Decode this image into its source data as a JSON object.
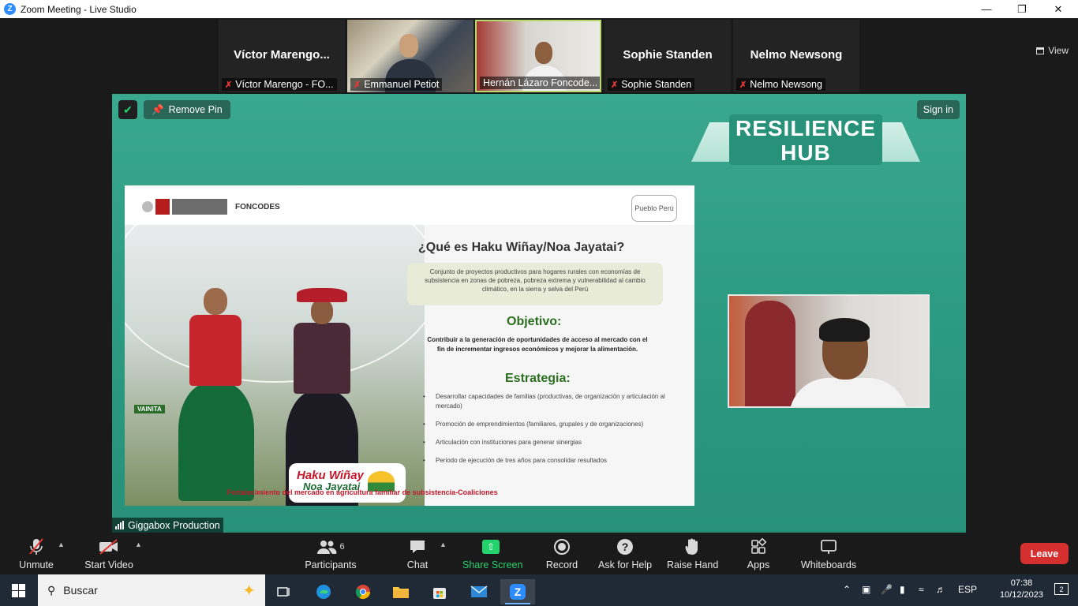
{
  "window": {
    "title": "Zoom Meeting - Live Studio",
    "app_icon": "zoom-icon",
    "controls": [
      "minimize-icon",
      "restore-icon",
      "close-icon"
    ]
  },
  "thumbnails": [
    {
      "big_name": "Víctor  Marengo...",
      "label": "Víctor Marengo - FO...",
      "muted": true,
      "video": false
    },
    {
      "big_name": "",
      "label": "Emmanuel Petiot",
      "muted": true,
      "video": true
    },
    {
      "big_name": "",
      "label": "Hernán Lázaro Foncode...",
      "muted": false,
      "video": true,
      "active": true
    },
    {
      "big_name": "Sophie Standen",
      "label": "Sophie Standen",
      "muted": true,
      "video": false
    },
    {
      "big_name": "Nelmo Newsong",
      "label": "Nelmo Newsong",
      "muted": true,
      "video": false
    }
  ],
  "view_button": {
    "label": "View",
    "icon": "grid-view-icon"
  },
  "share": {
    "remove_pin": "Remove Pin",
    "sign_in": "Sign in",
    "brand": {
      "line1": "RESILIENCE",
      "line2": "HUB"
    },
    "slide": {
      "header_logo_text": "FONCODES",
      "partner_logo_text": "Pueblo Perú",
      "title": "¿Qué es Haku Wiñay/Noa Jayatai?",
      "definition": "Conjunto de proyectos productivos para hogares rurales con economías de subsistencia en zonas de pobreza, pobreza extrema y vulnerabilidad al cambio climático, en la sierra y selva del Perú",
      "objective_heading": "Objetivo:",
      "objective_text": "Contribuir a la generación de oportunidades de acceso al mercado con el fin de incrementar ingresos económicos y mejorar la alimentación.",
      "strategy_heading": "Estrategia:",
      "strategy_items": [
        "Desarrollar capacidades de familias (productivas, de organización y articulación al mercado)",
        "Promoción de emprendimientos (familiares, grupales y de organizaciones)",
        "Articulación con instituciones para generar sinergias",
        "Periodo de ejecución de tres años para consolidar resultados"
      ],
      "footer": "Fortalecimiento del mercado en agricultura familiar de subsistencia-Coaliciones",
      "badge_line1": "Haku Wiñay",
      "badge_line2": "Noa Jayatai",
      "photo_tag": "VAINITA"
    }
  },
  "producer_label": "Giggabox Production",
  "toolbar": {
    "unmute": "Unmute",
    "start_video": "Start Video",
    "participants": "Participants",
    "participants_count": "6",
    "chat": "Chat",
    "share_screen": "Share Screen",
    "record": "Record",
    "ask_for_help": "Ask for Help",
    "raise_hand": "Raise Hand",
    "apps": "Apps",
    "whiteboards": "Whiteboards",
    "leave": "Leave",
    "accent": "#23d36b",
    "leave_color": "#d62f2f"
  },
  "taskbar": {
    "search_placeholder": "Buscar",
    "language": "ESP",
    "time": "07:38",
    "date": "10/12/2023",
    "notifications": "2",
    "apps": [
      "task-view-icon",
      "edge-icon",
      "chrome-icon",
      "file-explorer-icon",
      "store-icon",
      "mail-icon",
      "zoom-icon"
    ]
  }
}
